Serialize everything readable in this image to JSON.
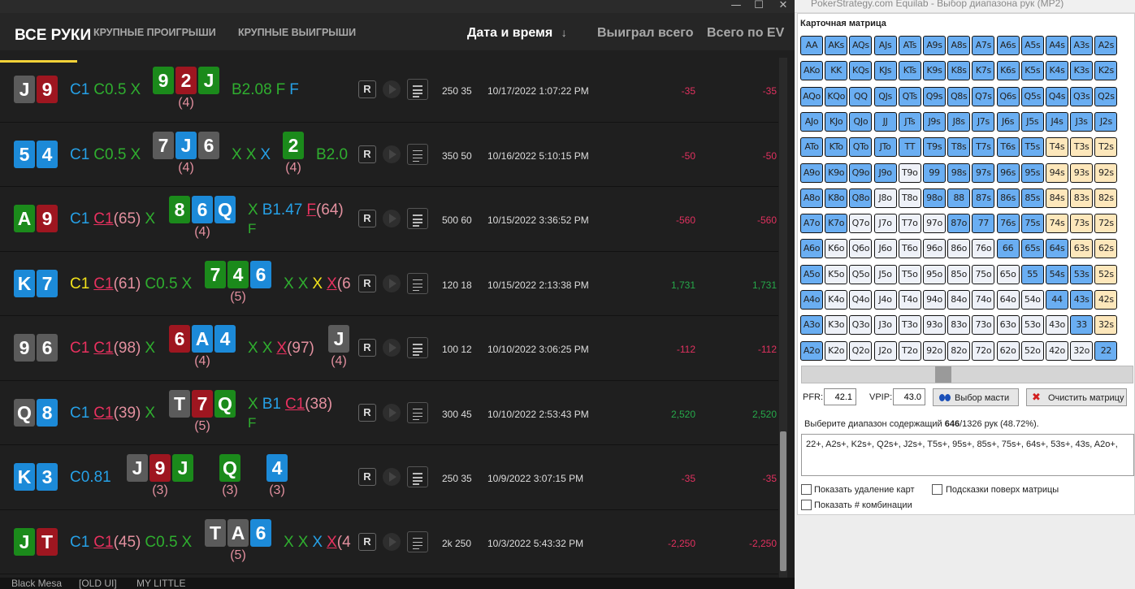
{
  "window": {
    "minimize": "—",
    "maximize": "☐",
    "close": "✕"
  },
  "tabs": [
    "ВСЕ РУКИ",
    "КРУПНЫЕ ПРОИГРЫШИ",
    "КРУПНЫЕ ВЫИГРЫШИ"
  ],
  "headers": {
    "date": "Дата и время",
    "sort": "↓",
    "won": "Выиграл всего",
    "ev": "Всего по EV"
  },
  "taskbar": [
    "Black Mesa",
    "[OLD UI]",
    "MY LITTLE"
  ],
  "hands": [
    {
      "hole": [
        [
          "J",
          "s"
        ],
        [
          "9",
          "h"
        ]
      ],
      "pre": [
        [
          "C1",
          "b"
        ],
        [
          "C0.5",
          "g"
        ],
        [
          "X",
          "g"
        ]
      ],
      "board": [
        {
          "cards": [
            [
              "9",
              "c"
            ],
            [
              "2",
              "h"
            ],
            [
              "J",
              "c"
            ]
          ],
          "count": "(4)"
        }
      ],
      "acts": [
        [
          [
            "B2.08",
            "g"
          ],
          [
            "F",
            "g"
          ],
          [
            "F",
            "b"
          ]
        ]
      ],
      "stakes": "250 35",
      "date": "10/17/2022 1:07:22 PM",
      "won": "-35",
      "ev": "-35"
    },
    {
      "hole": [
        [
          "5",
          "d"
        ],
        [
          "4",
          "d"
        ]
      ],
      "pre": [
        [
          "C1",
          "b"
        ],
        [
          "C0.5",
          "g"
        ],
        [
          "X",
          "g"
        ]
      ],
      "board": [
        {
          "cards": [
            [
              "7",
              "s"
            ],
            [
              "J",
              "d"
            ],
            [
              "6",
              "s"
            ]
          ],
          "count": "(4)"
        },
        {
          "cards": [
            [
              "2",
              "c"
            ]
          ],
          "count": "(4)"
        }
      ],
      "acts": [
        [
          [
            "X",
            "g"
          ],
          [
            "X",
            "g"
          ],
          [
            "X",
            "b"
          ]
        ],
        [
          [
            "B2.0",
            "g"
          ]
        ]
      ],
      "stakes": "350 50",
      "date": "10/16/2022 5:10:15 PM",
      "won": "-50",
      "ev": "-50"
    },
    {
      "hole": [
        [
          "A",
          "c"
        ],
        [
          "9",
          "h"
        ]
      ],
      "pre": [
        [
          "C1",
          "b"
        ],
        [
          "C1",
          "pu"
        ],
        [
          "(65)",
          "p"
        ],
        [
          "X",
          "g"
        ]
      ],
      "board": [
        {
          "cards": [
            [
              "8",
              "c"
            ],
            [
              "6",
              "d"
            ],
            [
              "Q",
              "d"
            ]
          ],
          "count": "(4)"
        }
      ],
      "acts": [
        [
          [
            "X",
            "g"
          ],
          [
            "B1.47",
            "b"
          ],
          [
            "F",
            "ru"
          ],
          [
            "(64)",
            "p"
          ]
        ]
      ],
      "acts2": "F",
      "stakes": "500 60",
      "date": "10/15/2022 3:36:52 PM",
      "won": "-560",
      "ev": "-560"
    },
    {
      "hole": [
        [
          "K",
          "d"
        ],
        [
          "7",
          "d"
        ]
      ],
      "pre": [
        [
          "C1",
          "y"
        ],
        [
          "C1",
          "pu"
        ],
        [
          "(61)",
          "p"
        ],
        [
          "C0.5",
          "g"
        ],
        [
          "X",
          "g"
        ]
      ],
      "board": [
        {
          "cards": [
            [
              "7",
              "c"
            ],
            [
              "4",
              "c"
            ],
            [
              "6",
              "d"
            ]
          ],
          "count": "(5)"
        }
      ],
      "acts": [
        [
          [
            "X",
            "g"
          ],
          [
            "X",
            "g"
          ],
          [
            "X",
            "y"
          ],
          [
            "X",
            "pu"
          ],
          [
            "(6",
            "p"
          ]
        ]
      ],
      "stakes": "120 18",
      "date": "10/15/2022 2:13:38 PM",
      "won": "1,731",
      "ev": "1,731"
    },
    {
      "hole": [
        [
          "9",
          "s"
        ],
        [
          "6",
          "s"
        ]
      ],
      "pre": [
        [
          "C1",
          "r"
        ],
        [
          "C1",
          "pu"
        ],
        [
          "(98)",
          "p"
        ],
        [
          "X",
          "g"
        ]
      ],
      "board": [
        {
          "cards": [
            [
              "6",
              "h"
            ],
            [
              "A",
              "d"
            ],
            [
              "4",
              "d"
            ]
          ],
          "count": "(4)"
        },
        {
          "cards": [
            [
              "J",
              "s"
            ]
          ],
          "count": "(4)"
        }
      ],
      "acts": [
        [
          [
            "X",
            "g"
          ],
          [
            "X",
            "g"
          ],
          [
            "X",
            "pu"
          ],
          [
            "(97)",
            "p"
          ]
        ]
      ],
      "stakes": "100 12",
      "date": "10/10/2022 3:06:25 PM",
      "won": "-112",
      "ev": "-112"
    },
    {
      "hole": [
        [
          "Q",
          "s"
        ],
        [
          "8",
          "d"
        ]
      ],
      "pre": [
        [
          "C1",
          "b"
        ],
        [
          "C1",
          "pu"
        ],
        [
          "(39)",
          "p"
        ],
        [
          "X",
          "g"
        ]
      ],
      "board": [
        {
          "cards": [
            [
              "T",
              "s"
            ],
            [
              "7",
              "h"
            ],
            [
              "Q",
              "c"
            ]
          ],
          "count": "(5)"
        }
      ],
      "acts": [
        [
          [
            "X",
            "g"
          ],
          [
            "B1",
            "b"
          ],
          [
            "C1",
            "pu"
          ],
          [
            "(38)",
            "p"
          ]
        ]
      ],
      "acts2": "F",
      "stakes": "300 45",
      "date": "10/10/2022 2:53:43 PM",
      "won": "2,520",
      "ev": "2,520"
    },
    {
      "hole": [
        [
          "K",
          "d"
        ],
        [
          "3",
          "d"
        ]
      ],
      "pre": [
        [
          "C0.81",
          "b"
        ]
      ],
      "board": [
        {
          "cards": [
            [
              "J",
              "s"
            ],
            [
              "9",
              "h"
            ],
            [
              "J",
              "c"
            ]
          ],
          "count": "(3)"
        },
        {
          "cards": [
            [
              "Q",
              "c"
            ]
          ],
          "count": "(3)"
        },
        {
          "cards": [
            [
              "4",
              "d"
            ]
          ],
          "count": "(3)"
        }
      ],
      "acts": [],
      "stakes": "250 35",
      "date": "10/9/2022 3:07:15 PM",
      "won": "-35",
      "ev": "-35"
    },
    {
      "hole": [
        [
          "J",
          "c"
        ],
        [
          "T",
          "h"
        ]
      ],
      "pre": [
        [
          "C1",
          "b"
        ],
        [
          "C1",
          "pu"
        ],
        [
          "(45)",
          "p"
        ],
        [
          "C0.5",
          "g"
        ],
        [
          "X",
          "g"
        ]
      ],
      "board": [
        {
          "cards": [
            [
              "T",
              "s"
            ],
            [
              "A",
              "s"
            ],
            [
              "6",
              "d"
            ]
          ],
          "count": "(5)"
        }
      ],
      "acts": [
        [
          [
            "X",
            "g"
          ],
          [
            "X",
            "g"
          ],
          [
            "X",
            "b"
          ],
          [
            "X",
            "pu"
          ],
          [
            "(4",
            "p"
          ]
        ]
      ],
      "stakes": "2k 250",
      "date": "10/3/2022 5:43:32 PM",
      "won": "-2,250",
      "ev": "-2,250"
    }
  ],
  "equilab": {
    "title": "PokerStrategy.com Equilab - Выбор диапазона рук (MP2)",
    "matrix_title": "Карточная матрица",
    "ranks": [
      "A",
      "K",
      "Q",
      "J",
      "T",
      "9",
      "8",
      "7",
      "6",
      "5",
      "4",
      "3",
      "2"
    ],
    "matrix_rows": [
      "SSSSSSSSSSSSS",
      "SSSSSSSSSSSSS",
      "SSSSSSSSSSSSS",
      "SSSSSSSSSSSSS",
      "SSSSSSSSSSYYY",
      "SSSSNSSSSSYYY",
      "SSSNNSSSSSYYY",
      "SSNNNNSSSSYYY",
      "SNNNNNNNSSSYY",
      "SNNNNNNNNSSSY",
      "SNNNNNNNNNSSY",
      "SNNNNNNNNNNSY",
      "SNNNNNNNNNNNS"
    ],
    "pfr_label": "PFR:",
    "pfr": "42.1",
    "vpip_label": "VPIP:",
    "vpip": "43.0",
    "suit_btn": "Выбор масти",
    "clear_btn": "Очистить матрицу",
    "summary_pre": "Выберите диапазон содержащий ",
    "summary_num": "646",
    "summary_post": "/1326 рук (48.72%).",
    "range": "22+, A2s+, K2s+, Q2s+, J2s+, T5s+, 95s+, 85s+, 75s+, 64s+, 53s+, 43s, A2o+,",
    "opt1": "Показать удаление карт",
    "opt2": "Подсказки поверх матрицы",
    "opt3": "Показать # комбинации"
  },
  "colors": {
    "blue": "#26a0e6",
    "green": "#2fae2f",
    "yellow": "#f2e21a",
    "pink": "#e8315f",
    "salmon": "#e3909f",
    "selected": "#6aaef2",
    "partial": "#fde7bb"
  }
}
